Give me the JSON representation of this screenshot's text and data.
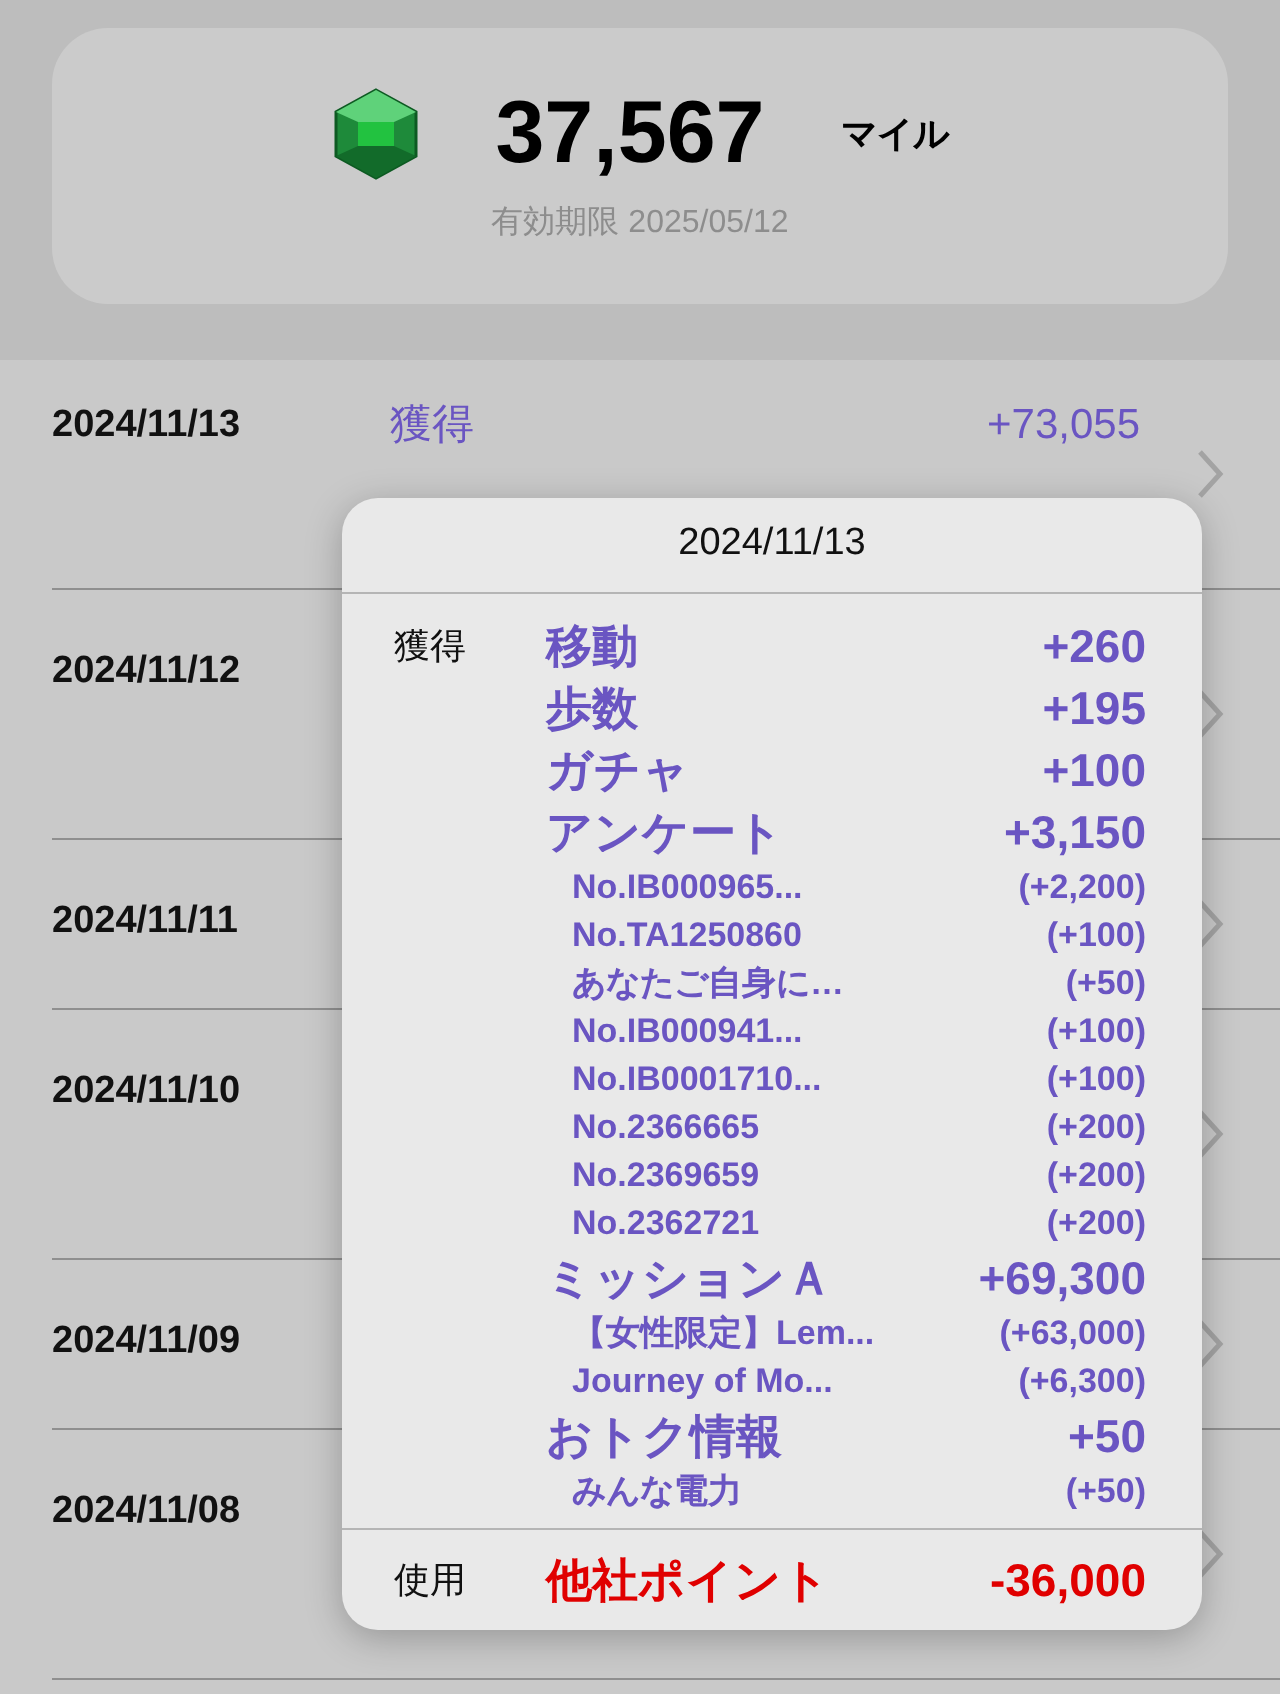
{
  "summary": {
    "miles": "37,567",
    "unit": "マイル",
    "expiry": "有効期限 2025/05/12"
  },
  "history": [
    {
      "date": "2024/11/13",
      "entries": [
        {
          "kind": "earn",
          "label": "獲得",
          "amount": "+73,055"
        }
      ]
    },
    {
      "date": "2024/11/12"
    },
    {
      "date": "2024/11/11"
    },
    {
      "date": "2024/11/10"
    },
    {
      "date": "2024/11/09"
    },
    {
      "date": "2024/11/08"
    }
  ],
  "detail_popup": {
    "date": "2024/11/13",
    "sections": [
      {
        "kind": "earn",
        "label": "獲得",
        "items": [
          {
            "name": "移動",
            "amount": "+260"
          },
          {
            "name": "歩数",
            "amount": "+195"
          },
          {
            "name": "ガチャ",
            "amount": "+100"
          },
          {
            "name": "アンケート",
            "amount": "+3,150",
            "children": [
              {
                "name": "No.IB000965...",
                "amount": "(+2,200)"
              },
              {
                "name": "No.TA1250860",
                "amount": "(+100)"
              },
              {
                "name": "あなたご自身に…",
                "amount": "(+50)"
              },
              {
                "name": "No.IB000941...",
                "amount": "(+100)"
              },
              {
                "name": "No.IB0001710...",
                "amount": "(+100)"
              },
              {
                "name": "No.2366665",
                "amount": "(+200)"
              },
              {
                "name": "No.2369659",
                "amount": "(+200)"
              },
              {
                "name": "No.2362721",
                "amount": "(+200)"
              }
            ]
          },
          {
            "name": "ミッションＡ",
            "amount": "+69,300",
            "children": [
              {
                "name": "【女性限定】Lem...",
                "amount": "(+63,000)"
              },
              {
                "name": "Journey of Mo...",
                "amount": "(+6,300)"
              }
            ]
          },
          {
            "name": "おトク情報",
            "amount": "+50",
            "children": [
              {
                "name": "みんな電力",
                "amount": "(+50)"
              }
            ]
          }
        ]
      },
      {
        "kind": "use",
        "label": "使用",
        "items": [
          {
            "name": "他社ポイント",
            "amount": "-36,000"
          }
        ]
      }
    ]
  }
}
